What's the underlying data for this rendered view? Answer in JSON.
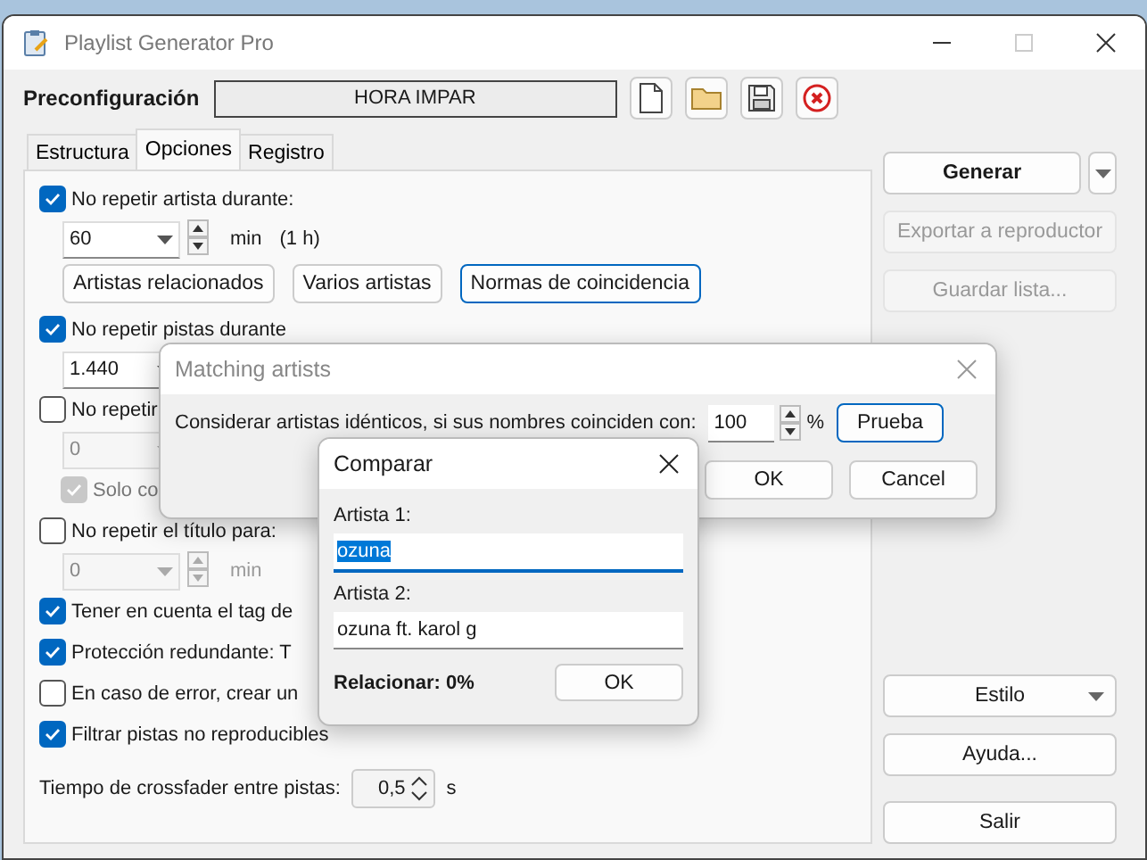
{
  "window": {
    "title": "Playlist Generator Pro"
  },
  "preset": {
    "label": "Preconfiguración",
    "value": "HORA IMPAR"
  },
  "tabs": [
    {
      "label": "Estructura",
      "selected": false
    },
    {
      "label": "Opciones",
      "selected": true
    },
    {
      "label": "Registro",
      "selected": false
    }
  ],
  "options": [
    {
      "kind": "check",
      "label": "No repetir artista durante:",
      "checked": true
    },
    {
      "kind": "spin",
      "value": "60",
      "spin_buttons": true,
      "unit": "min",
      "note": "(1 h)",
      "disabled": false
    },
    {
      "kind": "buttons",
      "buttons": [
        {
          "label": "Artistas relacionados",
          "focused": false
        },
        {
          "label": "Varios artistas",
          "focused": false
        },
        {
          "label": "Normas de coincidencia",
          "focused": true
        }
      ]
    },
    {
      "kind": "check",
      "label": "No repetir pistas durante",
      "checked": true
    },
    {
      "kind": "spin",
      "value": "1.440",
      "disabled": false
    },
    {
      "kind": "check",
      "label": "No repetir",
      "checked": false
    },
    {
      "kind": "spin",
      "value": "0",
      "disabled": true
    },
    {
      "kind": "subcheck",
      "label": "Solo co",
      "checked": true,
      "disabled": true
    },
    {
      "kind": "check",
      "label": "No repetir el título para:",
      "checked": false
    },
    {
      "kind": "spin",
      "value": "0",
      "spin_buttons": true,
      "unit": "min",
      "disabled": true
    },
    {
      "kind": "check",
      "label": "Tener en cuenta el tag de",
      "checked": true
    },
    {
      "kind": "check",
      "label": "Protección redundante: T",
      "checked": true
    },
    {
      "kind": "check",
      "label": "En caso de error, crear un",
      "checked": false
    },
    {
      "kind": "check",
      "label": "Filtrar pistas no reproducibles",
      "checked": true
    }
  ],
  "crossfader": {
    "label": "Tiempo de crossfader entre pistas:",
    "value": "0,5",
    "unit": "s"
  },
  "actions": [
    {
      "label": "Generar",
      "kind": "split"
    },
    {
      "label": "Exportar a reproductor",
      "kind": "plain",
      "disabled": true
    },
    {
      "label": "Guardar lista...",
      "kind": "plain",
      "disabled": true
    }
  ],
  "bottom_actions": [
    {
      "label": "Estilo",
      "kind": "dropdown"
    },
    {
      "label": "Ayuda...",
      "kind": "plain"
    },
    {
      "label": "Salir",
      "kind": "exit"
    }
  ],
  "matching_dialog": {
    "title": "Matching artists",
    "text": "Considerar artistas idénticos, si sus nombres coinciden con:",
    "value": "100",
    "unit": "%",
    "test_button": "Prueba",
    "buttons": [
      "OK",
      "Cancel"
    ]
  },
  "compare_dialog": {
    "title": "Comparar",
    "fields": [
      {
        "label": "Artista 1:",
        "value": "ozuna",
        "text_selected": true
      },
      {
        "label": "Artista 2:",
        "value": "ozuna ft. karol g",
        "text_selected": false
      }
    ],
    "result": "Relacionar: 0%",
    "button": "OK"
  }
}
